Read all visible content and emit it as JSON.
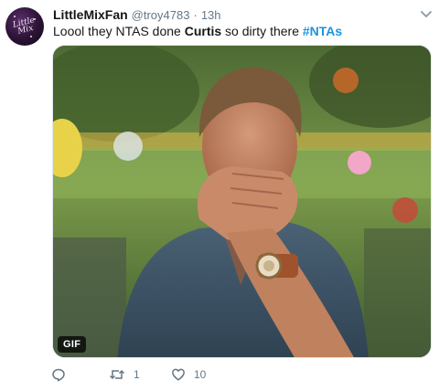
{
  "tweet": {
    "display_name": "LittleMixFan",
    "handle": "@troy4783",
    "separator": "·",
    "time": "13h",
    "text_parts": {
      "part1": "Loool they NTAS done ",
      "bold": "Curtis",
      "part2": " so dirty there ",
      "hashtag": "#NTAs"
    },
    "avatar": {
      "logo_text": "Little Mix",
      "icon": "avatar-logo"
    },
    "media": {
      "badge": "GIF",
      "description_icon": "gif-media"
    },
    "actions": {
      "reply": {
        "icon": "reply-icon",
        "count": ""
      },
      "retweet": {
        "icon": "retweet-icon",
        "count": "1"
      },
      "like": {
        "icon": "heart-icon",
        "count": "10"
      }
    },
    "menu_icon": "chevron-down-icon"
  },
  "colors": {
    "text": "#14171a",
    "secondary": "#657786",
    "link": "#1b95e0"
  }
}
